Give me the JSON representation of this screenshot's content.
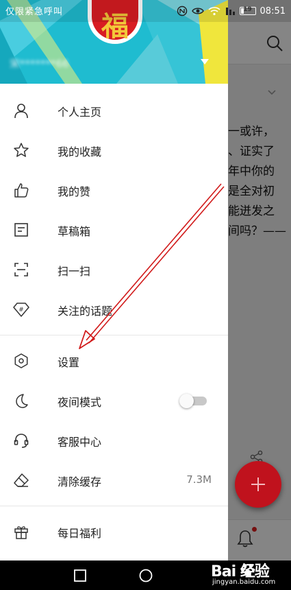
{
  "status_bar": {
    "carrier_text": "仅限紧急呼叫",
    "battery_level": "19",
    "time": "08:51"
  },
  "drawer": {
    "avatar_glyph": "福",
    "username": "宋*******66"
  },
  "menu": {
    "group1": [
      {
        "label": "个人主页",
        "icon": "person-icon"
      },
      {
        "label": "我的收藏",
        "icon": "star-icon"
      },
      {
        "label": "我的赞",
        "icon": "thumbs-up-icon"
      },
      {
        "label": "草稿箱",
        "icon": "draft-icon"
      },
      {
        "label": "扫一扫",
        "icon": "scan-icon"
      },
      {
        "label": "关注的话题",
        "icon": "topic-icon"
      }
    ],
    "group2": [
      {
        "label": "设置",
        "icon": "settings-icon"
      },
      {
        "label": "夜间模式",
        "icon": "moon-icon",
        "toggle_on": false
      },
      {
        "label": "客服中心",
        "icon": "headset-icon"
      },
      {
        "label": "清除缓存",
        "icon": "eraser-icon",
        "value": "7.3M"
      }
    ],
    "group3": [
      {
        "label": "每日福利",
        "icon": "gift-icon"
      }
    ]
  },
  "background": {
    "article_lines": [
      "一或许，",
      "、证实了",
      "年中你的",
      "是全对初",
      "能迸发之",
      "间吗？——"
    ]
  },
  "watermark": {
    "brand": "Bai 经验",
    "sub": "jingyan.baidu.com"
  },
  "colors": {
    "header_cyan": "#1fbcd0",
    "header_yellow": "#f0e63c",
    "fab_red": "#c0121d",
    "annotation_red": "#d11a1a"
  }
}
